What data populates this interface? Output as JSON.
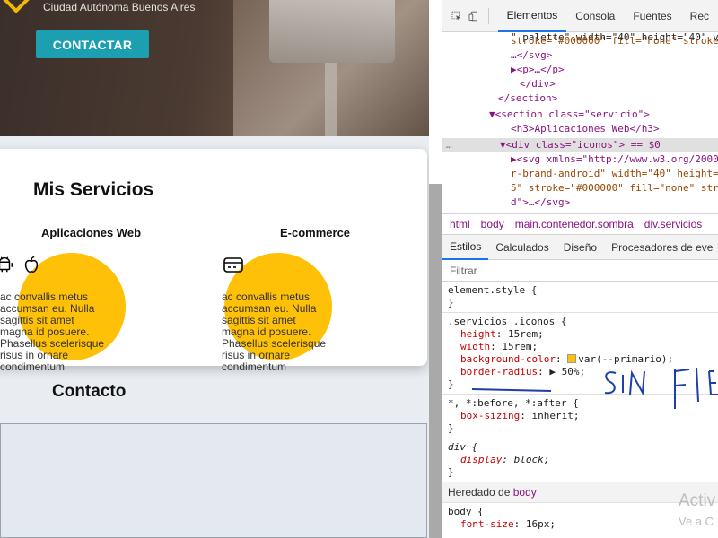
{
  "page": {
    "hero": {
      "city": "Ciudad Autónoma Buenos Aires",
      "cta_label": "CONTACTAR"
    },
    "services": {
      "title": "Mis Servicios",
      "items": [
        {
          "title": "Aplicaciones Web",
          "icons": [
            "android-icon",
            "apple-icon"
          ],
          "text": "ac convallis metus accumsan eu. Nulla sagittis sit amet magna id posuere. Phasellus scelerisque risus in ornare condimentum"
        },
        {
          "title": "E-commerce",
          "icons": [
            "credit-card-icon"
          ],
          "text": "ac convallis metus accumsan eu. Nulla sagittis sit amet magna id posuere. Phasellus scelerisque risus in ornare condimentum"
        }
      ]
    },
    "contact": {
      "title": "Contacto"
    }
  },
  "devtools": {
    "tabs": [
      "Elementos",
      "Consola",
      "Fuentes",
      "Rec"
    ],
    "active_tab": "Elementos",
    "dom_lines": [
      {
        "indent": 0,
        "text": "\" palette\" width=\"40\" height=\"40\" vi"
      },
      {
        "indent": 0,
        "text": "stroke=\"#000000\" fill=\"none\" stroke-"
      },
      {
        "indent": 0,
        "text": "…</svg>"
      },
      {
        "indent": 0,
        "text": "▶<p>…</p>"
      },
      {
        "indent": 0,
        "text": "</div>"
      },
      {
        "indent": 0,
        "text": "</section>"
      },
      {
        "indent": 0,
        "text": "▼<section class=\"servicio\">"
      },
      {
        "indent": 0,
        "text": "<h3>Aplicaciones Web</h3>"
      },
      {
        "indent": 0,
        "text": "▼<div class=\"iconos\"> == $0"
      },
      {
        "indent": 0,
        "text": "▶<svg xmlns=\"http://www.w3.org/2000"
      },
      {
        "indent": 0,
        "text": "r-brand-android\" width=\"40\" height=\""
      },
      {
        "indent": 0,
        "text": "5\" stroke=\"#000000\" fill=\"none\" stro"
      },
      {
        "indent": 0,
        "text": "d\">…</svg>"
      }
    ],
    "breadcrumbs": [
      "html",
      "body",
      "main.contenedor.sombra",
      "div.servicios"
    ],
    "subtabs": [
      "Estilos",
      "Calculados",
      "Diseño",
      "Procesadores de eve"
    ],
    "active_subtab": "Estilos",
    "filter_placeholder": "Filtrar",
    "rules": [
      {
        "selector": "element.style {",
        "props": [],
        "close": "}"
      },
      {
        "selector": ".servicios .iconos {",
        "props": [
          {
            "name": "height",
            "value": "15rem;"
          },
          {
            "name": "width",
            "value": "15rem;"
          },
          {
            "name": "background-color",
            "value": "var(--primario);",
            "swatch": "#ffc107"
          },
          {
            "name": "border-radius",
            "value": "▶ 50%;"
          }
        ],
        "close": "}"
      },
      {
        "selector": "*, *:before, *:after {",
        "props": [
          {
            "name": "box-sizing",
            "value": "inherit;"
          }
        ],
        "close": "}"
      },
      {
        "selector": "div {",
        "props": [
          {
            "name": "display",
            "value": "block;"
          }
        ],
        "close": "}"
      }
    ],
    "inherited_label": "Heredado de",
    "inherited_from": "body",
    "body_rule": {
      "selector": "body {",
      "prop_name": "font-size",
      "prop_value": "16px;"
    },
    "watermark": {
      "line1": "Activ",
      "line2": "Ve a C"
    },
    "annotation": "SIN FLEX"
  },
  "colors": {
    "primary": "#ffc107",
    "cta": "#1b9fb1",
    "devtools_accent": "#1a73e8"
  }
}
